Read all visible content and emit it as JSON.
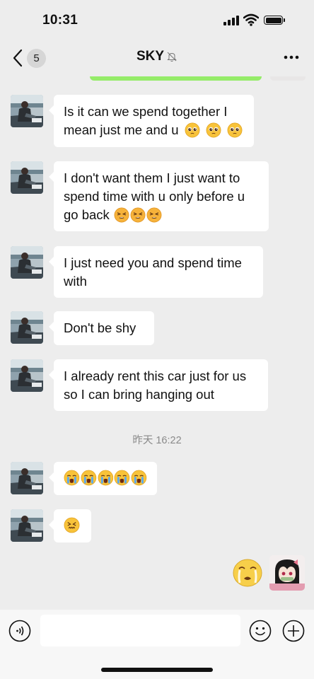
{
  "status_bar": {
    "time": "10:31"
  },
  "header": {
    "back_badge": "5",
    "title": "SKY",
    "icons": {
      "back": "chevron-left-icon",
      "mute": "bell-off-icon",
      "more": "more-horizontal-icon"
    }
  },
  "messages": [
    {
      "sender": "SKY",
      "text": "Is it can we spend together I mean just me and u",
      "emoji": [
        "pleading-face",
        "pleading-face",
        "pleading-face"
      ]
    },
    {
      "sender": "SKY",
      "text": "I don't want them I just want to spend time with u only before u go back",
      "emoji": [
        "persevering-face",
        "persevering-face",
        "persevering-face"
      ]
    },
    {
      "sender": "SKY",
      "text": "I just need you and spend time with",
      "emoji": []
    },
    {
      "sender": "SKY",
      "text": "Don't be shy",
      "emoji": []
    },
    {
      "sender": "SKY",
      "text": "I already rent this car just for us so I can bring hanging out",
      "emoji": []
    },
    {
      "sender": "SKY",
      "text": "",
      "emoji": [
        "loudly-crying-face",
        "loudly-crying-face",
        "loudly-crying-face",
        "loudly-crying-face",
        "loudly-crying-face"
      ]
    },
    {
      "sender": "SKY",
      "text": "",
      "emoji": [
        "confounded-face"
      ]
    },
    {
      "sender": "me",
      "text": "",
      "emoji": [
        "crying-sticker"
      ]
    }
  ],
  "timestamp": "昨天 16:22",
  "input_bar": {
    "placeholder": "",
    "icons": {
      "voice": "voice-icon",
      "emoji": "emoji-icon",
      "add": "plus-circle-icon"
    }
  },
  "colors": {
    "background": "#ededed",
    "bubble_incoming": "#ffffff",
    "bubble_outgoing": "#95ec69",
    "timestamp_text": "#8a8a8a",
    "input_bar": "#f7f7f7"
  }
}
